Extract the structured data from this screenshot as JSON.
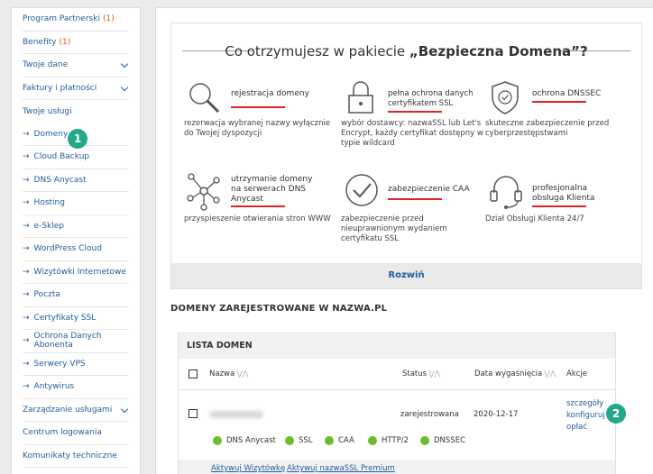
{
  "sidebar": {
    "items": [
      {
        "label": "Program Partnerski",
        "count": "(1)"
      },
      {
        "label": "Benefity",
        "count": "(1)"
      },
      {
        "label": "Twoje dane"
      },
      {
        "label": "Faktury i płatności"
      },
      {
        "label": "Twoje usługi"
      },
      {
        "label": "Domeny"
      },
      {
        "label": "Cloud Backup"
      },
      {
        "label": "DNS Anycast"
      },
      {
        "label": "Hosting"
      },
      {
        "label": "e-Sklep"
      },
      {
        "label": "WordPress Cloud"
      },
      {
        "label": "Wizytówki Internetowe"
      },
      {
        "label": "Poczta"
      },
      {
        "label": "Certyfikaty SSL"
      },
      {
        "label": "Ochrona Danych Abonenta"
      },
      {
        "label": "Serwery VPS"
      },
      {
        "label": "Antywirus"
      },
      {
        "label": "Zarządzanie usługami"
      },
      {
        "label": "Centrum logowania"
      },
      {
        "label": "Komunikaty techniczne"
      }
    ],
    "sub_arrow": "→"
  },
  "badges": {
    "one": "1",
    "two": "2"
  },
  "promo": {
    "title_prefix": "Co otrzymujesz w pakiecie ",
    "title_bold": "„Bezpieczna Domena”?",
    "features": [
      {
        "title": "rejestracja domeny",
        "desc": "rezerwacja wybranej nazwy wyłącznie do Twojej dyspozycji",
        "icon": "magnifier-icon"
      },
      {
        "title": "pełna ochrona danych certyfikatem SSL",
        "desc": "wybór dostawcy: nazwaSSL lub Let's Encrypt, każdy certyfikat dostępny w typie wildcard",
        "icon": "padlock-icon"
      },
      {
        "title": "ochrona DNSSEC",
        "desc": "skuteczne zabezpieczenie przed cyberprzestępstwami",
        "icon": "shield-icon"
      },
      {
        "title": "utrzymanie domeny na serwerach DNS Anycast",
        "desc": "przyspieszenie otwierania stron WWW",
        "icon": "network-icon"
      },
      {
        "title": "zabezpieczenie CAA",
        "desc": "zabezpieczenie przed nieuprawnionym wydaniem certyfikatu SSL",
        "icon": "check-circle-icon"
      },
      {
        "title": "profesjonalna obsługa Klienta",
        "desc": "Dział Obsługi Klienta 24/7",
        "icon": "headset-icon"
      }
    ],
    "expand_label": "Rozwiń"
  },
  "domains_section": {
    "title": "DOMENY ZAREJESTROWANE W NAZWA.PL",
    "list_title": "LISTA DOMEN",
    "columns": {
      "name": "Nazwa",
      "status": "Status",
      "expiry": "Data wygaśnięcia",
      "actions": "Akcje"
    },
    "sort_icon": "⋁⋀",
    "row": {
      "status": "zarejestrowana",
      "expiry": "2020-12-17",
      "actions": [
        "szczegóły",
        "konfiguruj",
        "opłać"
      ],
      "services": [
        "DNS Anycast",
        "SSL",
        "CAA",
        "HTTP/2",
        "DNSSEC"
      ]
    },
    "bottom_links": [
      "Aktywuj Wizytówkę",
      "Aktywuj nazwaSSL Premium"
    ]
  },
  "colors": {
    "accent": "#1f5d9c",
    "badge": "#24a889",
    "red": "#e02424",
    "green": "#6bbd2e",
    "count": "#e8590c"
  }
}
